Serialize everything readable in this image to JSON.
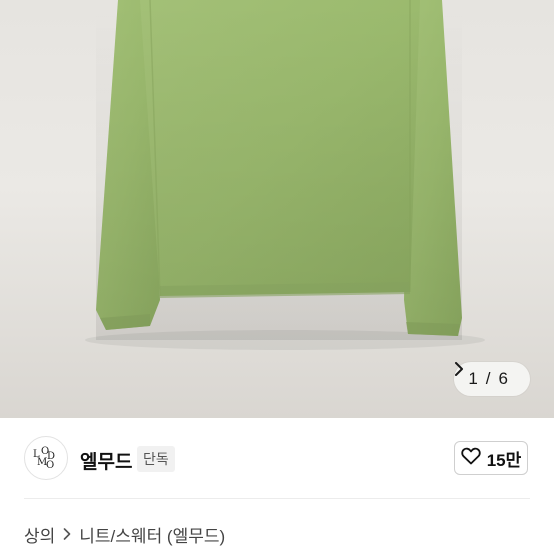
{
  "gallery": {
    "current_page": "1",
    "separator": "/",
    "total_pages": "6",
    "next_icon": "chevron-right-icon"
  },
  "seller": {
    "avatar_text": "LMOOD",
    "name": "엘무드",
    "badge": "단독"
  },
  "like": {
    "icon": "heart-outline-icon",
    "count": "15만"
  },
  "breadcrumb": {
    "category": "상의",
    "separator_icon": "chevron-right-icon",
    "subcategory": "니트/스웨터 (엘무드)"
  },
  "colors": {
    "sweater": "#9bba6e",
    "background": "#e8e6e2",
    "pager_bg": "#f4f4f2"
  }
}
